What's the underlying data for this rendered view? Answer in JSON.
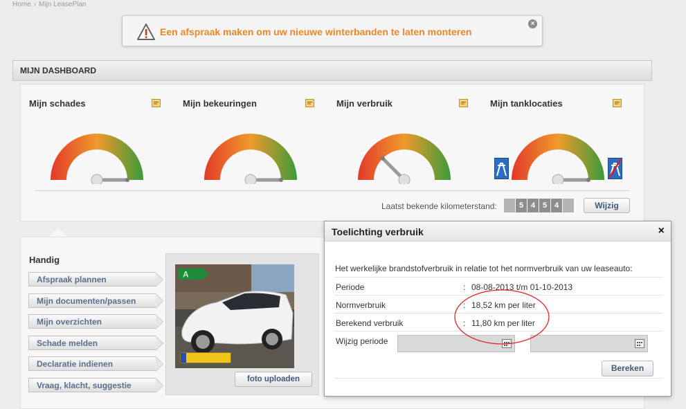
{
  "breadcrumb": {
    "home": "Home",
    "separator": "›",
    "current": "Mijn LeasePlan"
  },
  "alert": {
    "text": "Een afspraak maken om uw nieuwe winterbanden te laten monteren",
    "icon": "warning-icon",
    "close_icon": "close-icon",
    "color": "#e8882a"
  },
  "dashboard": {
    "title": "MIJN DASHBOARD",
    "gauges": [
      {
        "title": "Mijn schades",
        "needle_angle_deg": 0
      },
      {
        "title": "Mijn bekeuringen",
        "needle_angle_deg": 0
      },
      {
        "title": "Mijn verbruik",
        "needle_angle_deg": 135
      },
      {
        "title": "Mijn tanklocaties",
        "needle_angle_deg": 0
      }
    ],
    "km_label": "Laatst bekende kilometerstand:",
    "km_digits": [
      "",
      "5",
      "4",
      "5",
      "4",
      ""
    ],
    "wijzig_label": "Wijzig"
  },
  "handig": {
    "title": "Handig",
    "items": [
      "Afspraak plannen",
      "Mijn documenten/passen",
      "Mijn overzichten",
      "Schade melden",
      "Declaratie indienen",
      "Vraag, klacht, suggestie"
    ]
  },
  "photo": {
    "energy_label": "A",
    "upload_label": "foto uploaden"
  },
  "modal": {
    "title": "Toelichting verbruik",
    "close": "×",
    "intro": "Het werkelijke brandstofverbruik in relatie tot het normverbruik van uw leaseauto:",
    "rows": [
      {
        "label": "Periode",
        "colon": ":",
        "value": "08-08-2013 t/m 01-10-2013"
      },
      {
        "label": "Normverbruik",
        "colon": ":",
        "value": "18,52 km per liter"
      },
      {
        "label": "Berekend verbruik",
        "colon": ":",
        "value": "11,80 km per liter"
      }
    ],
    "period_label": "Wijzig periode",
    "date_from": "",
    "date_to": "",
    "bereken_label": "Bereken"
  },
  "colors": {
    "gauge_red": "#e23a2a",
    "gauge_orange": "#ef9a2c",
    "gauge_green": "#3e9a3a",
    "highlight": "#d9262a"
  }
}
